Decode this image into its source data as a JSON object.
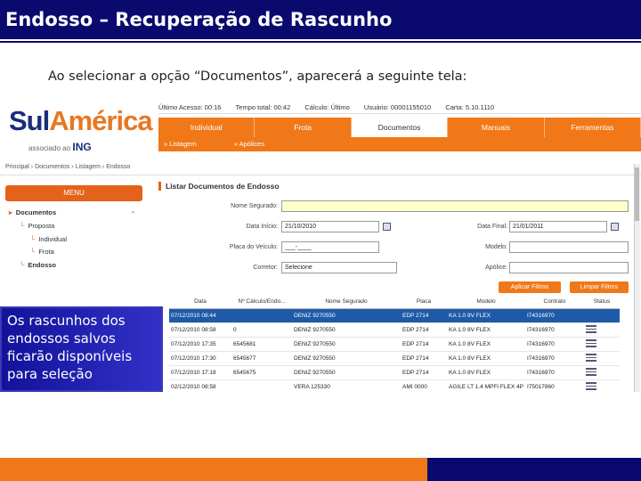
{
  "slide": {
    "title": "Endosso – Recuperação de Rascunho",
    "intro": "Ao selecionar a opção “Documentos”, aparecerá a seguinte tela:",
    "callout": "Os rascunhos dos\nendossos salvos\nficarão disponíveis\npara seleção",
    "colors": {
      "navy": "#0a0a6e",
      "orange": "#f07818",
      "selected_row": "#1e5aa8"
    }
  },
  "app": {
    "logo": {
      "main_1": "Sul",
      "main_2": "América",
      "sub": "associado ao",
      "ing": "ING"
    },
    "infobar": [
      "Último Acesso: 00:16",
      "Tempo total: 00:42",
      "Cálculo: Último",
      "Usuário: 00001155010",
      "Carta: 5.10.1110"
    ],
    "tabs": [
      {
        "label": "Individual",
        "active": false
      },
      {
        "label": "Frota",
        "active": false
      },
      {
        "label": "Documentos",
        "active": true
      },
      {
        "label": "Manuais",
        "active": false
      },
      {
        "label": "Ferramentas",
        "active": false
      }
    ],
    "subnav": [
      "» Listagem",
      "» Apólices"
    ],
    "breadcrumb": "Principal › Documentos › Listagem › Endosso",
    "menu": {
      "header": "MENU",
      "items": [
        {
          "label": "Documentos",
          "level": 0,
          "bold": true
        },
        {
          "label": "Proposta",
          "level": 1,
          "bold": false
        },
        {
          "label": "Individual",
          "level": 2,
          "bold": false
        },
        {
          "label": "Frota",
          "level": 2,
          "bold": false
        },
        {
          "label": "Endosso",
          "level": 1,
          "bold": true
        }
      ]
    },
    "form": {
      "title": "Listar Documentos de Endosso",
      "nome_segurado_label": "Nome Segurado:",
      "data_inicio_label": "Data Início:",
      "data_inicio_value": "21/10/2010",
      "data_final_label": "Data Final:",
      "data_final_value": "21/01/2011",
      "placa_label": "Placa do Veículo:",
      "placa_value": "___-____",
      "modelo_label": "Modelo:",
      "corretor_label": "Corretor:",
      "corretor_value": "Selecione",
      "apolice_label": "Apólice:",
      "btn_aplicar": "Aplicar Filtros",
      "btn_limpar": "Limpar Filtros"
    },
    "table": {
      "columns": [
        "Data",
        "Nº Cálculo/Endo...",
        "Nome Segurado",
        "Placa",
        "Modelo",
        "Contrato",
        "Status"
      ],
      "rows": [
        [
          "07/12/2010 08:44",
          "",
          "DENIZ 9270550",
          "EDP 2714",
          "KA 1.0 8V FLEX",
          "I74316970",
          "selected"
        ],
        [
          "07/12/2010 08:58",
          "0",
          "DENIZ 9270550",
          "EDP 2714",
          "KA 1.0 8V FLEX",
          "I74316970",
          ""
        ],
        [
          "07/12/2010 17:35",
          "6545681",
          "DENIZ 9270550",
          "EDP 2714",
          "KA 1.0 8V FLEX",
          "I74316970",
          ""
        ],
        [
          "07/12/2010 17:30",
          "6545677",
          "DENIZ 9270550",
          "EDP 2714",
          "KA 1.0 8V FLEX",
          "I74316970",
          ""
        ],
        [
          "07/12/2010 17:18",
          "6545675",
          "DENIZ 9270550",
          "EDP 2714",
          "KA 1.0 8V FLEX",
          "I74316970",
          ""
        ],
        [
          "02/12/2010 08:58",
          "",
          "VERA 125330",
          "AMI 0000",
          "AGILE LT 1.4 MPFI FLEX 4P",
          "I75017860",
          ""
        ]
      ]
    }
  }
}
